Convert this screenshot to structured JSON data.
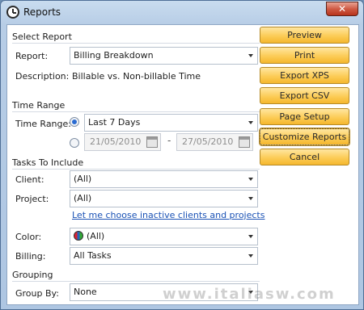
{
  "window": {
    "title": "Reports",
    "close_glyph": "✕"
  },
  "select_report": {
    "heading": "Select Report",
    "report_label": "Report:",
    "report_value": "Billing Breakdown",
    "description_label": "Description:",
    "description_value": "Billable vs. Non-billable Time"
  },
  "time_range": {
    "heading": "Time Range",
    "label": "Time Range:",
    "preset_value": "Last 7 Days",
    "preset_selected": true,
    "start_date": "21/05/2010",
    "end_date": "27/05/2010",
    "separator": "-"
  },
  "tasks": {
    "heading": "Tasks To Include",
    "client_label": "Client:",
    "client_value": "(All)",
    "project_label": "Project:",
    "project_value": "(All)",
    "inactive_link": "Let me choose inactive clients and projects",
    "color_label": "Color:",
    "color_value": "(All)",
    "billing_label": "Billing:",
    "billing_value": "All Tasks"
  },
  "grouping": {
    "heading": "Grouping",
    "group_by_label": "Group By:",
    "group_by_value": "None"
  },
  "buttons": {
    "preview": "Preview",
    "print": "Print",
    "export_xps": "Export XPS",
    "export_csv": "Export CSV",
    "page_setup": "Page Setup",
    "customize_reports": "Customize Reports",
    "cancel": "Cancel"
  },
  "watermark": "www.italiasw.com",
  "colors": {
    "button_fill": "#fccc57",
    "link": "#1a52b5",
    "radio_on": "#2a6bd1"
  }
}
